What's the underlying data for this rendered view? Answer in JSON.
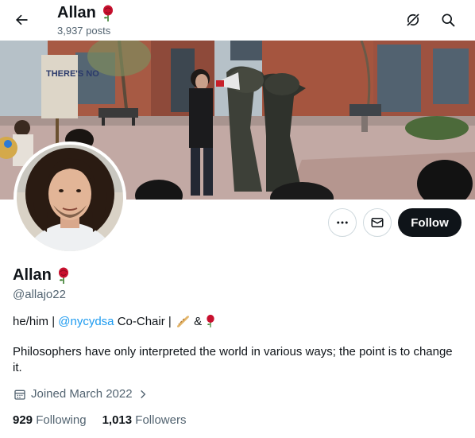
{
  "header": {
    "title": "Allan",
    "post_count": "3,937 posts",
    "back_icon": "arrow-left-icon",
    "grok_icon": "grok-icon",
    "search_icon": "search-icon"
  },
  "banner": {
    "sign_text": "THERE'S NO"
  },
  "actions": {
    "more_icon": "more-horizontal-icon",
    "message_icon": "envelope-icon",
    "follow_label": "Follow"
  },
  "profile": {
    "name": "Allan",
    "handle": "@allajo22",
    "bio_line1_prefix": "he/him | ",
    "bio_mention": "@nycydsa",
    "bio_line1_suffix": " Co-Chair | ",
    "bio_amp": " & ",
    "bio_line2": "Philosophers have only interpreted the world in various ways; the point is to change it.",
    "joined": "Joined March 2022",
    "following_count": "929",
    "following_label": "Following",
    "followers_count": "1,013",
    "followers_label": "Followers"
  },
  "colors": {
    "text": "#0f1419",
    "muted": "#536471",
    "link": "#1d9bf0",
    "rose": "#c8102e",
    "follow_bg": "#0f1419"
  }
}
